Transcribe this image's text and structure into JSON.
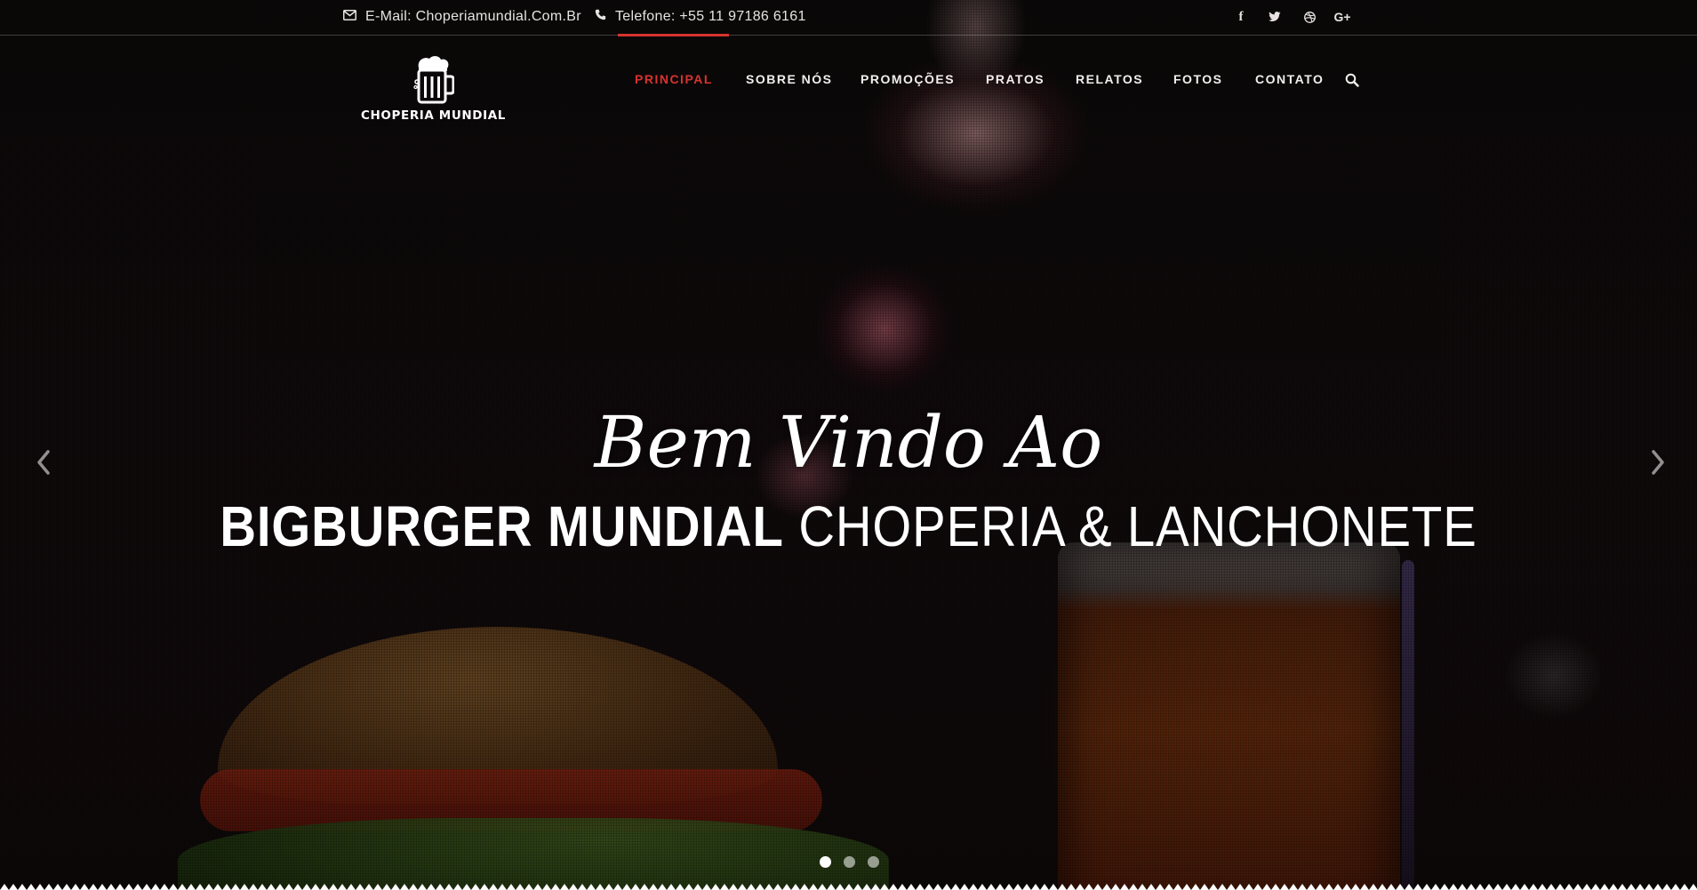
{
  "topbar": {
    "email_text": "E-Mail: Choperiamundial.Com.Br",
    "phone_text": "Telefone: +55 11 97186 6161",
    "email_icon": "envelope-icon",
    "phone_icon": "phone-icon",
    "social": [
      {
        "name": "facebook-icon",
        "glyph": "f"
      },
      {
        "name": "twitter-icon",
        "glyph": "t"
      },
      {
        "name": "dribbble-icon",
        "glyph": "d"
      },
      {
        "name": "google-plus-icon",
        "glyph": "G+"
      }
    ]
  },
  "logo": {
    "text": "CHOPERIA MUNDIAL",
    "icon": "beer-mug-icon"
  },
  "nav": {
    "items": [
      {
        "label": "PRINCIPAL",
        "active": true
      },
      {
        "label": "SOBRE NÓS",
        "active": false
      },
      {
        "label": "PROMOÇÕES",
        "active": false
      },
      {
        "label": "PRATOS",
        "active": false
      },
      {
        "label": "RELATOS",
        "active": false
      },
      {
        "label": "FOTOS",
        "active": false
      },
      {
        "label": "CONTATO",
        "active": false
      }
    ],
    "search_icon": "search-icon",
    "accent_color": "#d6332f"
  },
  "hero": {
    "welcome": "Bem Vindo Ao",
    "title_bold": "BIGBURGER MUNDIAL",
    "title_light": "CHOPERIA & LANCHONETE"
  },
  "slider": {
    "prev_icon": "chevron-left-icon",
    "next_icon": "chevron-right-icon",
    "dots": 3,
    "active_dot": 1
  }
}
